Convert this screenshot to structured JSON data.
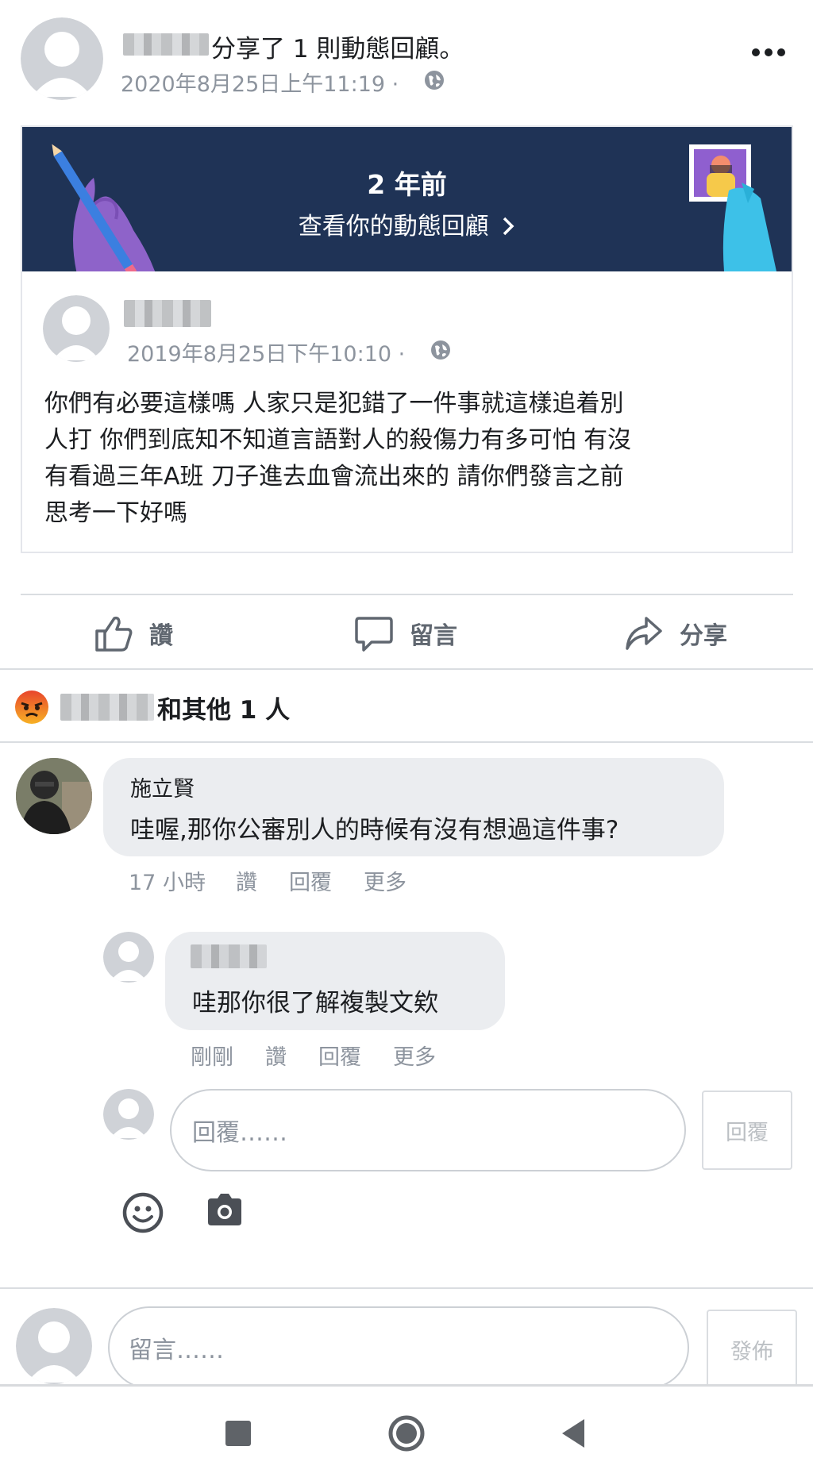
{
  "post": {
    "author_action": "分享了 1 則動態回顧。",
    "timestamp": "2020年8月25日上午11:19 ·",
    "more_label": "•••"
  },
  "memory_banner": {
    "title": "2 年前",
    "subtitle": "查看你的動態回顧",
    "colors": {
      "background": "#1f3356",
      "text": "#ffffff"
    }
  },
  "shared_post": {
    "timestamp": "2019年8月25日下午10:10 ·",
    "body_lines": [
      "你們有必要這樣嗎 人家只是犯錯了一件事就這樣追着別",
      "人打 你們到底知不知道言語對人的殺傷力有多可怕 有沒",
      "有看過三年A班 刀子進去血會流出來的 請你們發言之前",
      "思考一下好嗎"
    ]
  },
  "actions": {
    "like": "讚",
    "comment": "留言",
    "share": "分享"
  },
  "reactions": {
    "summary": "和其他 1 人"
  },
  "comments": [
    {
      "author": "施立賢",
      "text": "哇喔,那你公審別人的時候有沒有想過這件事?",
      "time": "17 小時",
      "like": "讚",
      "reply": "回覆",
      "more": "更多"
    }
  ],
  "replies": [
    {
      "text": "哇那你很了解複製文欸",
      "time": "剛剛",
      "like": "讚",
      "reply": "回覆",
      "more": "更多"
    }
  ],
  "reply_box": {
    "placeholder": "回覆……",
    "button": "回覆"
  },
  "comment_box": {
    "placeholder": "留言……",
    "button": "發佈"
  },
  "icons": {
    "more": "more-horizontal-icon",
    "globe": "globe-icon",
    "like": "thumbs-up-icon",
    "comment": "speech-bubble-icon",
    "share": "share-arrow-icon",
    "emoji": "smiley-icon",
    "camera": "camera-icon",
    "angry": "angry-reaction-icon",
    "nav_back": "back-triangle-icon",
    "nav_home": "home-circle-icon",
    "nav_recent": "recent-square-icon"
  }
}
